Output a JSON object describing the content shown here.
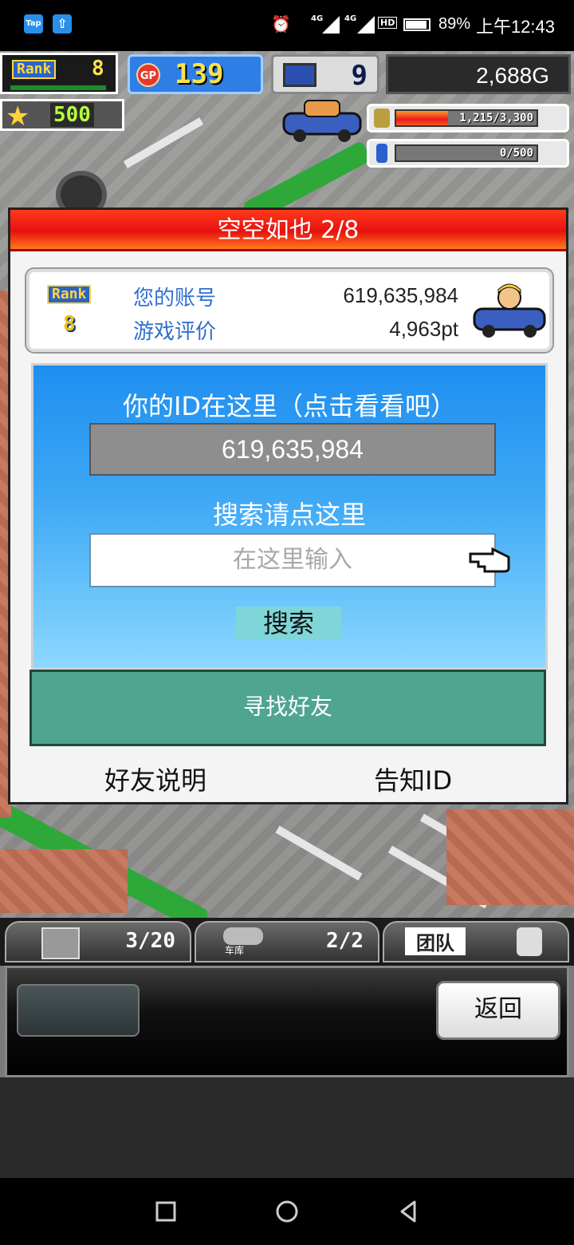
{
  "status_bar": {
    "app1": "Tap",
    "app2_icon": "upload-arrow-icon",
    "network1": "4G",
    "network2": "4G",
    "hd": "HD",
    "battery_pct": "89%",
    "time": "上午12:43"
  },
  "hud": {
    "rank_label": "Rank",
    "rank_value": "8",
    "gp_label": "GP",
    "gp_value": "139",
    "pc_value": "9",
    "money": "2,688G",
    "star_value": "500",
    "resource1_text": "1,215/3,300",
    "resource1_fraction": 0.368,
    "resource2_text": "0/500",
    "resource2_fraction": 0.0
  },
  "dialog": {
    "title": "空空如也 2/8",
    "profile": {
      "rank_label": "Rank",
      "rank_value": "8",
      "account_label": "您的账号",
      "account_value": "619,635,984",
      "rating_label": "游戏评价",
      "rating_value": "4,963pt"
    },
    "id_heading": "你的ID在这里（点击看看吧）",
    "id_value": "619,635,984",
    "search_heading": "搜索请点这里",
    "search_placeholder": "在这里输入",
    "search_button": "搜索",
    "find_friend_button": "寻找好友",
    "friend_help": "好友说明",
    "tell_id": "告知ID"
  },
  "bottom": {
    "tab1_count": "3/20",
    "tab2_label": "车库",
    "tab2_count": "2/2",
    "tab3_label": "团队",
    "back_button": "返回"
  },
  "colors": {
    "title_red": "#e81010",
    "panel_blue": "#3fa9f5",
    "friend_green": "#4fa590",
    "gp_blue": "#2e7ee6"
  }
}
